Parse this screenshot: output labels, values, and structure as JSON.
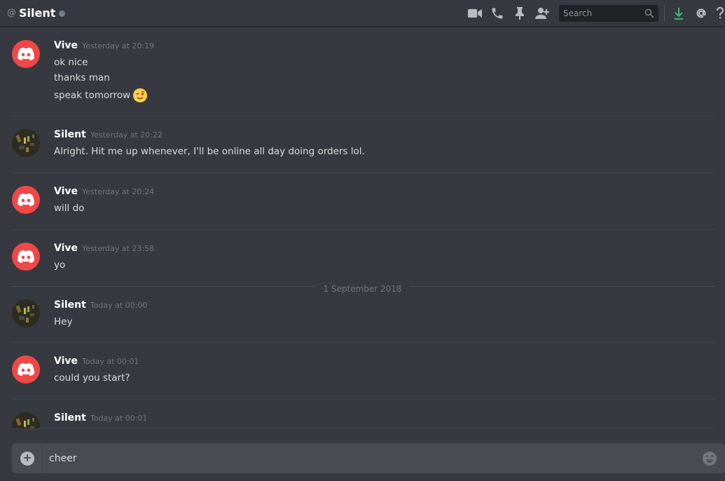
{
  "header": {
    "at_symbol": "@",
    "dm_name": "Silent",
    "search_placeholder": "Search",
    "icons": [
      "video-call-icon",
      "voice-call-icon",
      "pin-icon",
      "add-friend-icon",
      "search-icon",
      "download-icon",
      "mention-icon",
      "help-icon"
    ]
  },
  "messages": [
    {
      "username": "Vive",
      "timestamp": "Yesterday at 20:19",
      "lines": [
        "ok nice",
        "thanks man",
        "speak tomorrow"
      ],
      "emoji": "wink-emoji"
    },
    {
      "username": "Silent",
      "timestamp": "Yesterday at 20:22",
      "lines": [
        "Alright. Hit me up whenever, I'll be online all day doing orders lol."
      ]
    },
    {
      "username": "Vive",
      "timestamp": "Yesterday at 20:24",
      "lines": [
        "will do"
      ]
    },
    {
      "username": "Vive",
      "timestamp": "Yesterday at 23:58",
      "lines": [
        "yo"
      ]
    },
    {
      "username": "Silent",
      "timestamp": "Today at 00:00",
      "lines": [
        "Hey"
      ]
    },
    {
      "username": "Vive",
      "timestamp": "Today at 00:01",
      "lines": [
        "could you start?"
      ]
    },
    {
      "username": "Silent",
      "timestamp": "Today at 00:01",
      "lines": []
    }
  ],
  "date_divider": "1 September 2018",
  "composer": {
    "value": "cheer"
  },
  "colors": {
    "background": "#36393f",
    "vive_avatar": "#f04747",
    "composer_bg": "#484b51",
    "download_icon": "#43b581"
  }
}
